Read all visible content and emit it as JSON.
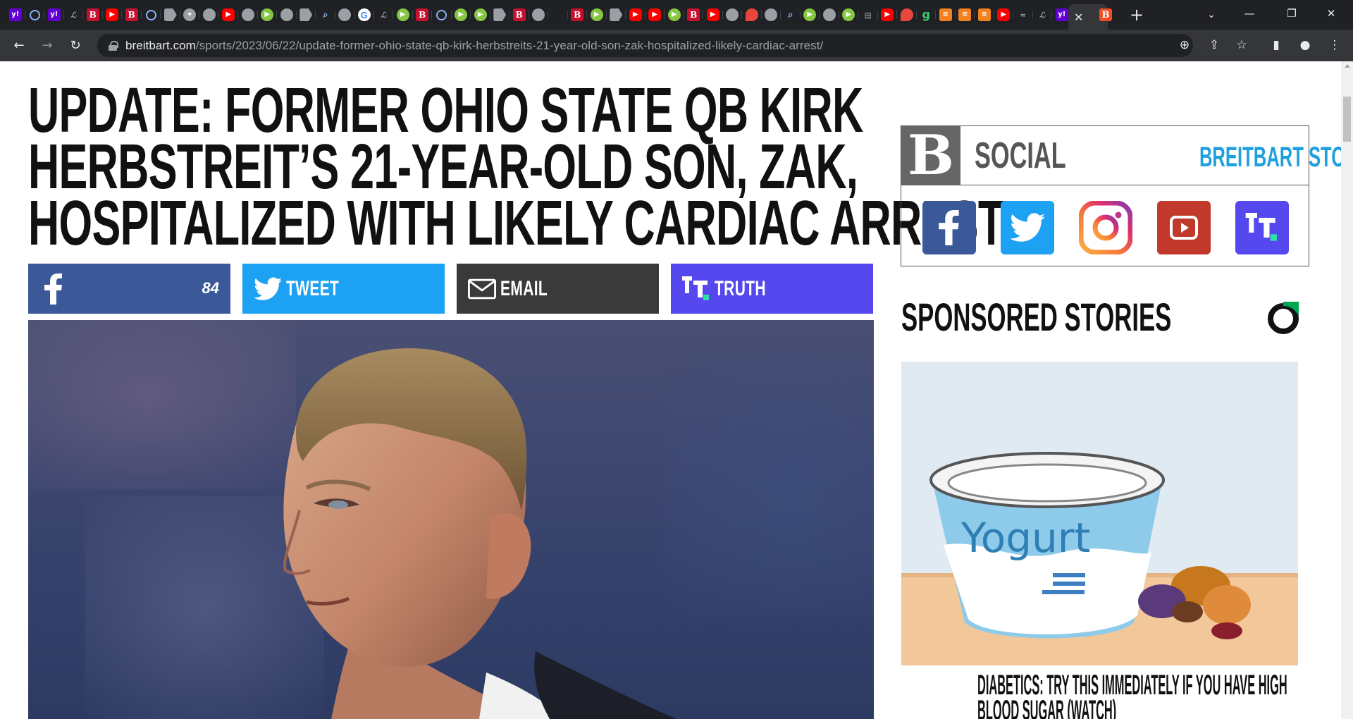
{
  "browser": {
    "tab_favicons": [
      "yahoo-icon",
      "ring-icon",
      "yahoo-icon",
      "nyt-icon",
      "breitbart-icon",
      "youtube-icon",
      "breitbart-icon",
      "ring-icon",
      "flag-icon",
      "map-icon",
      "globe-icon",
      "youtube-icon",
      "globe-icon",
      "rumble-icon",
      "globe-icon",
      "flag-icon",
      "search-icon",
      "globe-icon",
      "google-icon",
      "nyt-icon",
      "rumble-icon",
      "breitbart-icon",
      "ring-icon",
      "rumble-icon",
      "rumble-icon",
      "flag-icon",
      "breitbart-icon",
      "globe-icon",
      "dark-icon",
      "breitbart-icon",
      "rumble-icon",
      "flag-icon",
      "youtube-icon",
      "youtube-icon",
      "rumble-icon",
      "breitbart-icon",
      "youtube-icon",
      "globe-icon",
      "pin-icon",
      "globe-icon",
      "search-icon",
      "rumble-icon",
      "globe-icon",
      "rumble-icon",
      "news-icon",
      "youtube-icon",
      "pin-icon",
      "gab-icon",
      "bookmark-icon",
      "bookmark-icon",
      "bookmark-icon",
      "youtube-icon",
      "chart-icon",
      "nyt-icon",
      "yahoo-icon"
    ],
    "active_tab_close": "✕",
    "next_tab_favicon": "B",
    "new_tab": "+",
    "url_host": "breitbart.com",
    "url_path": "/sports/2023/06/22/update-former-ohio-state-qb-kirk-herbstreits-21-year-old-son-zak-hospitalized-likely-cardiac-arrest/"
  },
  "article": {
    "headline_lines": [
      "UPDATE: FORMER OHIO STATE QB KIRK",
      "HERBSTREIT’S 21-YEAR-OLD SON, ZAK,",
      "HOSPITALIZED WITH LIKELY CARDIAC ARREST"
    ],
    "share": {
      "facebook_count": "84",
      "tweet_label": "TWEET",
      "email_label": "EMAIL",
      "truth_label": "TRUTH"
    },
    "colors": {
      "facebook": "#3b5998",
      "twitter": "#1da1f2",
      "email": "#3a3a3a",
      "truth": "#5448ee"
    }
  },
  "sidebar": {
    "social_title": "SOCIAL",
    "store_link": "BREITBART STORE >",
    "social_icons": [
      "facebook-icon",
      "twitter-icon",
      "instagram-icon",
      "youtube-icon",
      "truth-social-icon"
    ],
    "sponsored_title": "SPONSORED STORIES",
    "ad": {
      "image_text": "Yogurt",
      "headline_lines": [
        "DIABETICS: TRY THIS IMMEDIATELY IF YOU HAVE HIGH",
        "BLOOD SUGAR (WATCH)"
      ]
    },
    "accent_color": "#1ea0dc"
  }
}
